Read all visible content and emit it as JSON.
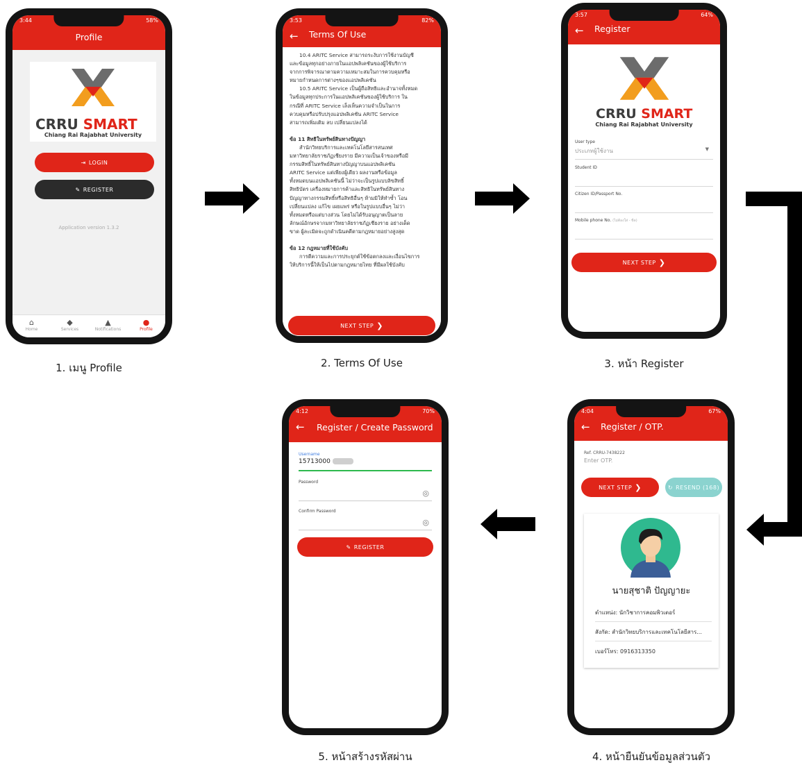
{
  "phone1": {
    "status_time": "3:44",
    "status_battery": "58%",
    "title": "Profile",
    "logo_word1": "CRRU",
    "logo_word2": "SMART",
    "logo_university": "Chiang Rai Rajabhat University",
    "login_label": "LOGIN",
    "register_label": "REGISTER",
    "version": "Application version 1.3.2",
    "nav": [
      "Home",
      "Services",
      "Notifications",
      "Profile"
    ]
  },
  "phone2": {
    "status_time": "3:53",
    "status_battery": "82%",
    "title": "Terms Of Use",
    "paragraphs": [
      "10.4 ARITC Service สามารถระงับการใช้งานบัญชี",
      "และข้อมูลทุกอย่างภายในแอปพลิเคชันของผู้ใช้บริการ",
      "จากการพิจารณาตามความเหมาะสมในการควบคุมหรือ",
      "หมายกำหนดการต่างๆของแอปพลิเคชัน",
      "10.5 ARITC Service เป็นผู้ถือสิทธิและอำนาจทั้งหมด",
      "ในข้อมูลทุกประการในแอปพลิเคชันของผู้ใช้บริการ ใน",
      "กรณีที่ ARITC Service เล็งเห็นความจำเป็นในการ",
      "ควบคุมหรือปรับปรุงแอปพลิเคชัน ARITC Service",
      "สามารถเพิ่มเติม ลบ เปลี่ยนแปลงได้"
    ],
    "heading11": "ข้อ 11 สิทธิในทรัพย์สินทางปัญญา",
    "paragraphs11": [
      "สำนักวิทยบริการและเทคโนโลยีสารสนเทศ",
      "มหาวิทยาลัยราชภัฏเชียงราย มีความเป็นเจ้าของหรือมี",
      "กรรมสิทธิ์ในทรัพย์สินทางปัญญาบนแอปพลิเคชัน",
      "ARITC Service แต่เพียงผู้เดียว ผลงานหรือข้อมูล",
      "ทั้งหมดบนแอปพลิเคชันนี้ ไม่ว่าจะเป็นรูปแบบลิขสิทธิ์",
      "สิทธิบัตร เครื่องหมายการค้าและสิทธิในทรัพย์สินทาง",
      "ปัญญาทางกรรมสิทธิ์หรือสิทธิอื่นๆ ห้ามมิให้ทำซ้ำ โอน",
      "เปลี่ยนแปลง แก้ไข เผยแพร่ หรือในรูปแบบอื่นๆ ไม่ว่า",
      "ทั้งหมดหรือแต่บางส่วน โดยไม่ได้รับอนุญาตเป็นลาย",
      "ลักษณ์อักษรจากมหาวิทยาลัยราชภัฏเชียงราย อย่างเด็ด",
      "ขาด ผู้ละเมิดจะถูกดำเนินคดีตามกฎหมายอย่างสูงสุด"
    ],
    "heading12": "ข้อ 12 กฎหมายที่ใช้บังคับ",
    "paragraphs12": [
      "การตีความและการประยุกต์ใช้ข้อตกลงและเงื่อนไขการ",
      "ให้บริการนี้ให้เป็นไปตามกฎหมายไทย ที่มีผลใช้บังคับ"
    ],
    "next_label": "NEXT STEP"
  },
  "phone3": {
    "status_time": "3:57",
    "status_battery": "64%",
    "title": "Register",
    "logo_word1": "CRRU",
    "logo_word2": "SMART",
    "logo_university": "Chiang Rai Rajabhat University",
    "user_type_label": "User type",
    "user_type_placeholder": "ประเภทผู้ใช้งาน",
    "student_id_label": "Student ID",
    "citizen_label": "Citizen ID/Passport No.",
    "mobile_label": "Mobile phone No.",
    "mobile_hint": "(ไม่ต้องใส่ - ขีด)",
    "next_label": "NEXT STEP"
  },
  "phone4": {
    "status_time": "4:04",
    "status_battery": "67%",
    "title": "Register / OTP.",
    "ref": "Ref. CRRU-7438222",
    "otp_placeholder": "Enter OTP.",
    "next_label": "NEXT STEP",
    "resend_label": "RESEND (168)",
    "name": "นายสุชาติ ปัญญายะ",
    "position": "ตำแหน่ง: นักวิชาการคอมพิวเตอร์",
    "department": "สังกัด: สำนักวิทยบริการและเทคโนโลยีสาร...",
    "phone": "เบอร์โทร: 0916313350"
  },
  "phone5": {
    "status_time": "4:12",
    "status_battery": "70%",
    "title": "Register / Create Password",
    "username_label": "Username",
    "username_value": "15713000",
    "password_label": "Password",
    "confirm_label": "Confirm Password",
    "register_label": "REGISTER"
  },
  "captions": {
    "c1": "1. เมนู Profile",
    "c2": "2. Terms Of Use",
    "c3": "3. หน้า Register",
    "c4": "4. หน้ายืนยันข้อมูลส่วนตัว",
    "c5": "5. หน้าสร้างรหัสผ่าน"
  },
  "colors": {
    "brand_red": "#e02519",
    "dark": "#2b2b2b",
    "teal": "#8bd3cf"
  }
}
